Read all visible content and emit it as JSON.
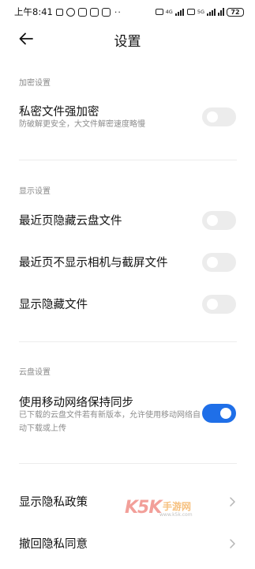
{
  "status_bar": {
    "time": "上午8:41",
    "network_left": "4G",
    "network_right": "5G",
    "battery": "72"
  },
  "header": {
    "title": "设置",
    "back_icon": "arrow-left-icon"
  },
  "sections": {
    "encryption": {
      "label": "加密设置",
      "items": [
        {
          "title": "私密文件强加密",
          "desc": "防破解更安全，大文件解密速度略慢",
          "enabled": false
        }
      ]
    },
    "display": {
      "label": "显示设置",
      "items": [
        {
          "title": "最近页隐藏云盘文件",
          "enabled": false
        },
        {
          "title": "最近页不显示相机与截屏文件",
          "enabled": false
        },
        {
          "title": "显示隐藏文件",
          "enabled": false
        }
      ]
    },
    "cloud": {
      "label": "云盘设置",
      "items": [
        {
          "title": "使用移动网络保持同步",
          "desc": "已下载的云盘文件若有新版本，允许使用移动网络自动下载或上传",
          "enabled": true
        }
      ]
    },
    "privacy": {
      "items": [
        {
          "title": "显示隐私政策"
        },
        {
          "title": "撤回隐私同意"
        }
      ]
    }
  },
  "watermark": {
    "brand": "K5K",
    "sub": "手游网",
    "url": "www.k5k.com"
  },
  "colors": {
    "accent": "#1f6fe8",
    "toggle_off": "#ececec",
    "secondary_text": "#8c8c8c"
  }
}
